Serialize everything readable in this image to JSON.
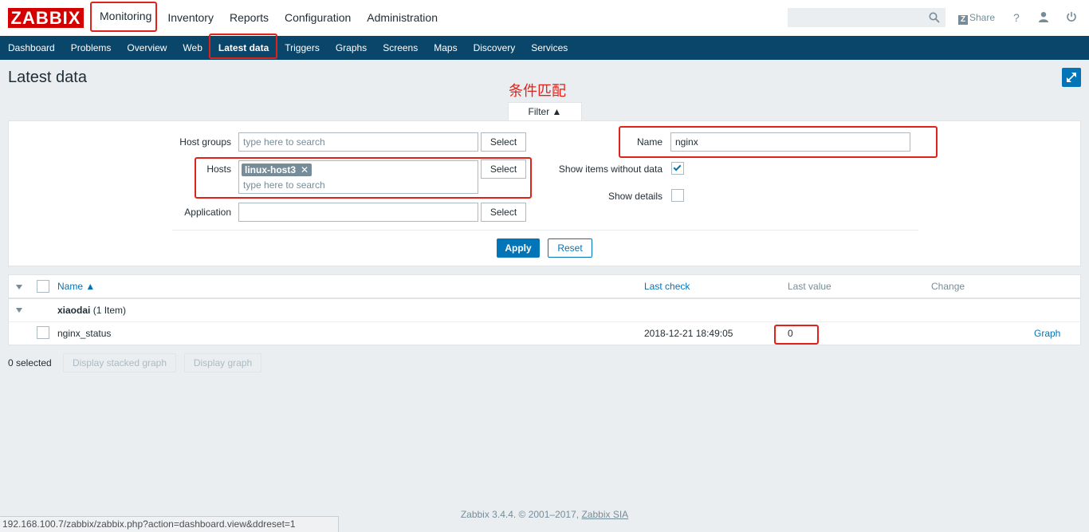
{
  "header": {
    "logo": "ZABBIX",
    "nav": [
      "Monitoring",
      "Inventory",
      "Reports",
      "Configuration",
      "Administration"
    ],
    "share_label": "Share",
    "help_icon": "?",
    "search_placeholder": ""
  },
  "subnav": [
    "Dashboard",
    "Problems",
    "Overview",
    "Web",
    "Latest data",
    "Triggers",
    "Graphs",
    "Screens",
    "Maps",
    "Discovery",
    "Services"
  ],
  "page": {
    "title": "Latest data",
    "annotation": "条件匹配"
  },
  "filter": {
    "tab_label": "Filter ▲",
    "host_groups_label": "Host groups",
    "host_groups_placeholder": "type here to search",
    "hosts_label": "Hosts",
    "host_tag": "linux-host3",
    "hosts_placeholder": "type here to search",
    "application_label": "Application",
    "application_value": "",
    "select_label": "Select",
    "name_label": "Name",
    "name_value": "nginx",
    "show_without_data_label": "Show items without data",
    "show_without_data_checked": true,
    "show_details_label": "Show details",
    "show_details_checked": false,
    "apply_label": "Apply",
    "reset_label": "Reset"
  },
  "table": {
    "columns": {
      "name": "Name ▲",
      "last_check": "Last check",
      "last_value": "Last value",
      "change": "Change"
    },
    "group": {
      "name": "xiaodai",
      "count": "(1 Item)"
    },
    "rows": [
      {
        "name": "nginx_status",
        "last_check": "2018-12-21 18:49:05",
        "last_value": "0",
        "change": "",
        "action": "Graph"
      }
    ]
  },
  "footer": {
    "selected": "0 selected",
    "stacked_graph": "Display stacked graph",
    "graph": "Display graph",
    "copyright": "Zabbix 3.4.4. © 2001–2017,",
    "company": "Zabbix SIA",
    "status_url": "192.168.100.7/zabbix/zabbix.php?action=dashboard.view&ddreset=1"
  },
  "colors": {
    "brand_red": "#d40000",
    "nav_blue": "#0a466a",
    "accent_blue": "#0275b8",
    "annotation_red": "#e0221b"
  }
}
